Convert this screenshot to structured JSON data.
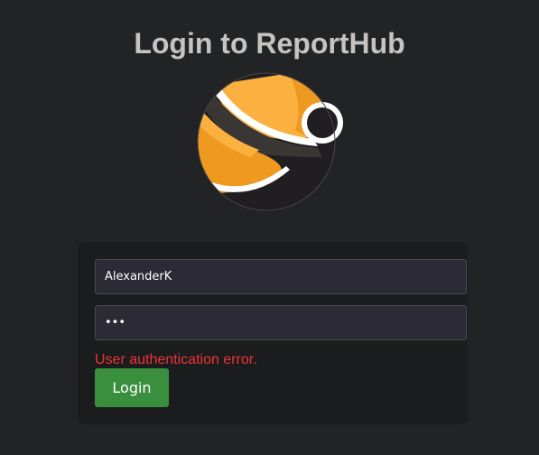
{
  "page": {
    "title": "Login to ReportHub"
  },
  "logo": {
    "icon": "reporthub-logo-icon",
    "colors": {
      "orange_light": "#fbb040",
      "orange_dark": "#ee9a20",
      "dark": "#201e20",
      "band": "#3a3634"
    }
  },
  "form": {
    "username": {
      "value": "AlexanderK",
      "placeholder": ""
    },
    "password": {
      "value": "•••",
      "placeholder": ""
    },
    "error_message": "User authentication error.",
    "login_label": "Login"
  },
  "colors": {
    "background": "#222325",
    "card": "#1b1c1e",
    "error": "#f03434",
    "button": "#3a8f3e"
  }
}
